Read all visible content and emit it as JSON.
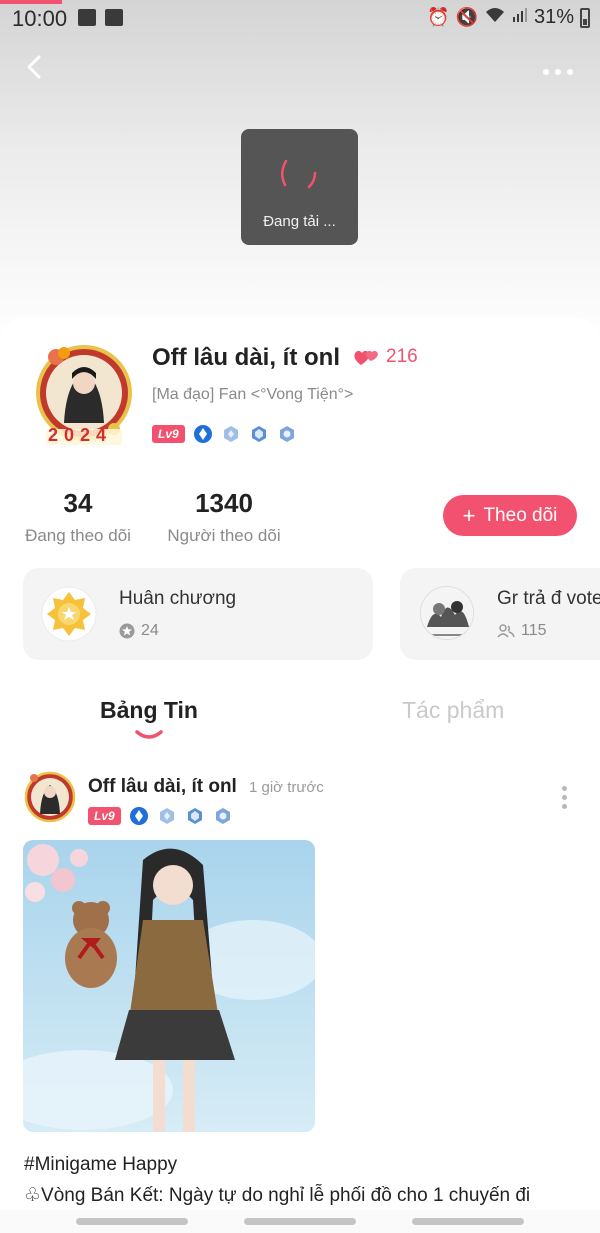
{
  "status_bar": {
    "time": "10:00",
    "battery": "31%"
  },
  "loading": {
    "text": "Đang tải ..."
  },
  "profile": {
    "username": "Off lâu dài, ít onl",
    "likes": "216",
    "subtitle": "[Ma đạo] Fan <°Vong Tiện°>",
    "level": "Lv9",
    "avatar_year": "2024"
  },
  "stats": {
    "following_count": "34",
    "following_label": "Đang theo dõi",
    "followers_count": "1340",
    "followers_label": "Người theo dõi"
  },
  "follow_button": {
    "icon": "+",
    "label": "Theo dõi"
  },
  "cards": {
    "medal_title": "Huân chương",
    "medal_count": "24",
    "group_title": "Gr trả đ vote",
    "group_members": "115"
  },
  "tabs": {
    "feed": "Bảng Tin",
    "works": "Tác phẩm"
  },
  "post": {
    "author": "Off lâu dài, ít onl",
    "time": "1 giờ trước",
    "level": "Lv9",
    "hashtag": "#Minigame Happy",
    "line2": "♧Vòng Bán Kết: Ngày tự do nghỉ lễ phối đồ cho 1 chuyến đi"
  },
  "colors": {
    "accent": "#f2526f",
    "toast": "#555555",
    "card_bg": "#f4f4f4"
  }
}
